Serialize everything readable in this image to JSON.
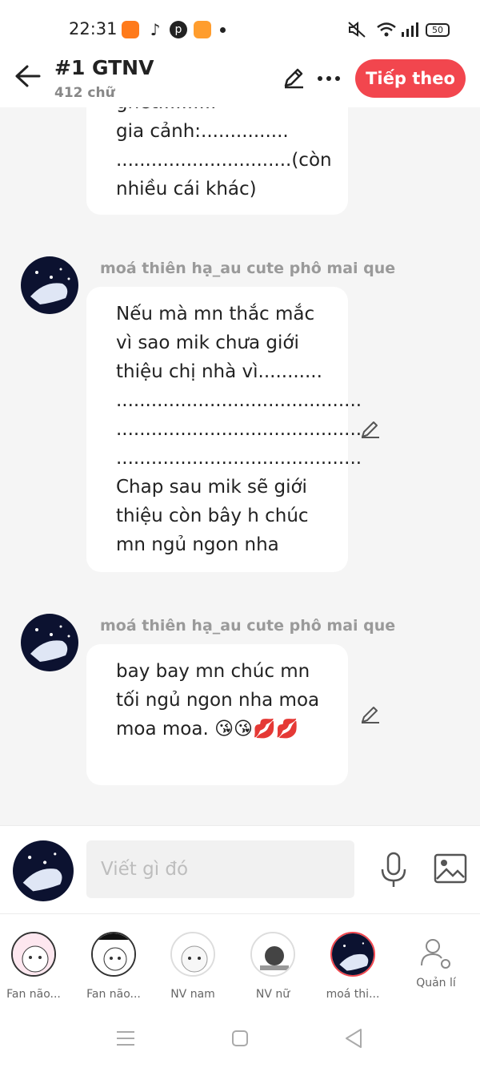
{
  "status": {
    "time": "22:31",
    "battery": "50"
  },
  "header": {
    "title": "#1 GTNV",
    "word_count": "412 chữ",
    "next_button": "Tiếp theo"
  },
  "messages": [
    {
      "lines": [
        "gia cảnh:...............",
        "..............................(còn",
        "nhiều cái khác)"
      ],
      "partial_top_line": "ghét.........."
    },
    {
      "author": "moá thiên hạ_au cute phô mai que",
      "lines": [
        "Nếu mà mn thắc mắc",
        "vì sao mik chưa giới",
        "thiệu chị nhà vì...........",
        "..........................................",
        "..........................................",
        "..........................................",
        "Chap sau mik sẽ giới",
        "thiệu còn bây h chúc",
        "mn ngủ ngon nha"
      ]
    },
    {
      "author": "moá thiên hạ_au cute phô mai que",
      "lines": [
        "bay bay mn chúc mn",
        "tối ngủ ngon nha moa",
        "moa moa. 😘😘💋💋"
      ]
    }
  ],
  "composer": {
    "placeholder": "Viết gì đó"
  },
  "characters": [
    {
      "label": "Fan não..."
    },
    {
      "label": "Fan não..."
    },
    {
      "label": "NV nam"
    },
    {
      "label": "NV nữ"
    },
    {
      "label": "moá thi..."
    },
    {
      "label": "Quản lí"
    }
  ],
  "colors": {
    "accent": "#f2464e",
    "background": "#f5f5f5"
  }
}
